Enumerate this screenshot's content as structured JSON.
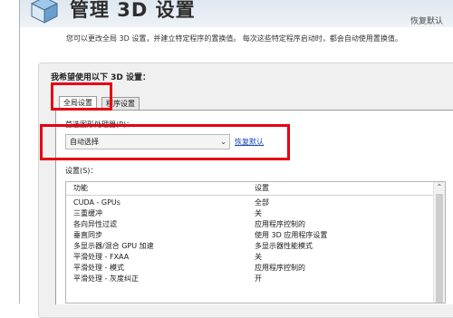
{
  "header": {
    "title": "管理 3D 设置",
    "restore_link": "恢复默认",
    "description": "您可以更改全局 3D 设置，并建立特定程序的置换值。 每次这些特定程序启动时，都会自动使用置换值。"
  },
  "panel": {
    "heading": "我希望使用以下 3D 设置：",
    "tabs": [
      {
        "label": "全局设置",
        "active": true
      },
      {
        "label": "程序设置",
        "active": false
      }
    ],
    "gpu_label": "首选图形处理器(P)：",
    "gpu_value": "自动选择",
    "restore_settings_link": "恢复默认",
    "settings_label": "设置(S)：",
    "table": {
      "columns": [
        "功能",
        "设置"
      ],
      "rows": [
        {
          "feature": "CUDA - GPUs",
          "setting": "全部"
        },
        {
          "feature": "三重缓冲",
          "setting": "关"
        },
        {
          "feature": "各向异性过滤",
          "setting": "应用程序控制的"
        },
        {
          "feature": "垂直同步",
          "setting": "使用 3D 应用程序设置"
        },
        {
          "feature": "多显示器/混合 GPU 加速",
          "setting": "多显示器性能模式"
        },
        {
          "feature": "平滑处理 - FXAA",
          "setting": "关"
        },
        {
          "feature": "平滑处理 - 模式",
          "setting": "应用程序控制的"
        },
        {
          "feature": "平滑处理 - 灰度纠正",
          "setting": "开"
        }
      ]
    }
  },
  "colors": {
    "highlight": "#e60012",
    "link": "#1646b8"
  }
}
